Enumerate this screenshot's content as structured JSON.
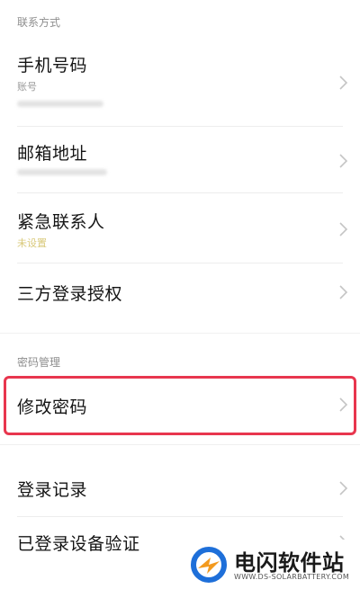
{
  "sections": {
    "contact": "联系方式",
    "password": "密码管理"
  },
  "rows": {
    "phone": {
      "title": "手机号码",
      "sub": "账号"
    },
    "email": {
      "title": "邮箱地址"
    },
    "emergency": {
      "title": "紧急联系人",
      "sub": "未设置"
    },
    "third_party": {
      "title": "三方登录授权"
    },
    "change_password": {
      "title": "修改密码"
    },
    "login_records": {
      "title": "登录记录"
    },
    "device_verify": {
      "title": "已登录设备验证"
    }
  },
  "watermark": {
    "name": "电闪软件站",
    "url": "WWW.DS-SOLARBATTERY.COM"
  },
  "colors": {
    "highlight": "#e8364e",
    "pending_text": "#d9c97a",
    "logo_blue": "#1e6fd9",
    "logo_orange": "#f39a1e"
  },
  "icons": {
    "chevron": "chevron-right-icon"
  }
}
